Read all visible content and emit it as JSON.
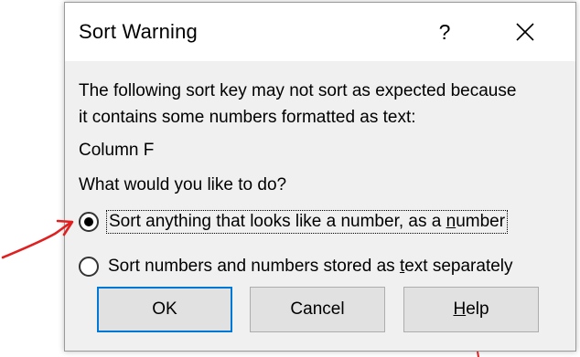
{
  "dialog": {
    "title": "Sort Warning",
    "help_glyph": "?",
    "message_line1": "The following sort key may not sort as expected because",
    "message_line2": "it contains some numbers formatted as text:",
    "column": "Column F",
    "question": "What would you like to do?",
    "options": [
      {
        "label_before": "Sort anything that looks like a number, as a ",
        "label_mnemonic": "n",
        "label_after": "umber",
        "checked": true
      },
      {
        "label_before": "Sort numbers and numbers stored as ",
        "label_mnemonic": "t",
        "label_after": "ext separately",
        "checked": false
      }
    ],
    "buttons": {
      "ok": "OK",
      "cancel": "Cancel",
      "help_mnemonic": "H",
      "help_rest": "elp"
    }
  },
  "colors": {
    "dialog_bg": "#f0f0f0",
    "titlebar_bg": "#ffffff",
    "button_bg": "#e1e1e1",
    "default_button_border": "#0078d7",
    "annotation_arrow": "#e02020"
  },
  "icons": {
    "close": "close-icon",
    "annotation": "red-arrow-icon"
  }
}
